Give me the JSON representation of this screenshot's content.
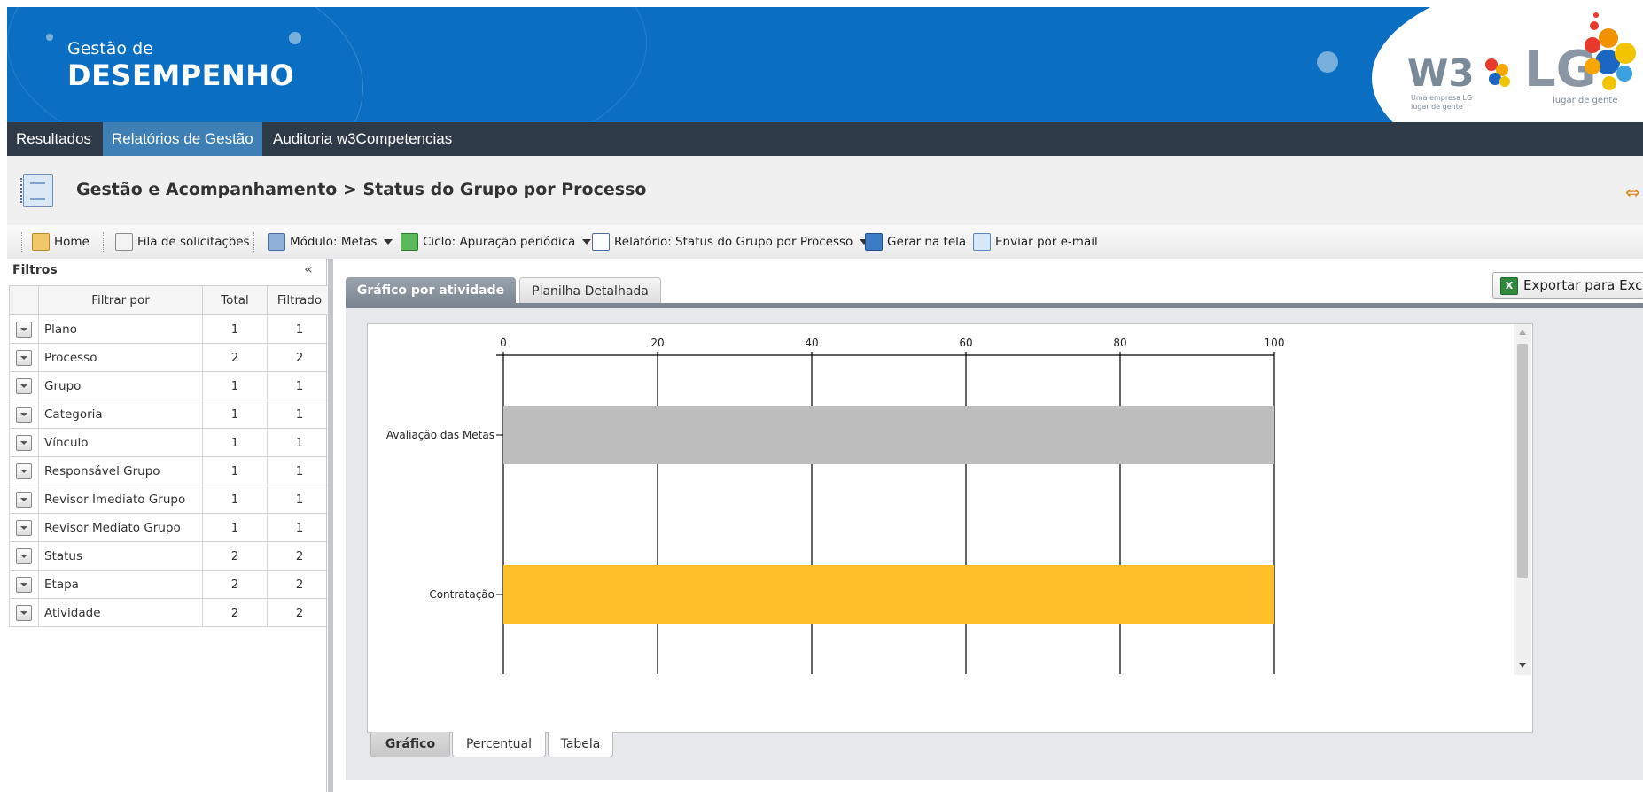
{
  "header": {
    "brand_line1": "Gestão de",
    "brand_line2": "DESEMPENHO",
    "logo_w3": "W3",
    "logo_w3_sub": "Uma empresa LG lugar de gente",
    "logo_lg": "LG",
    "logo_lg_sub": "lugar de gente",
    "colors": {
      "banner": "#0a6fc2",
      "menu": "#2e3a47",
      "menu_active": "#3e7fb5"
    }
  },
  "menu": {
    "items": [
      {
        "label": "Resultados",
        "active": false
      },
      {
        "label": "Relatórios de Gestão",
        "active": true
      },
      {
        "label": "Auditoria w3Competencias",
        "active": false
      }
    ]
  },
  "page": {
    "title": "Gestão e Acompanhamento > Status do Grupo por Processo",
    "title_icon": "report-notebook-icon",
    "expand_icon": "expand-arrows-icon"
  },
  "toolbar": {
    "home": "Home",
    "queue": "Fila de solicitações",
    "module": "Módulo: Metas",
    "cycle": "Ciclo: Apuração periódica",
    "report": "Relatório: Status do Grupo por Processo",
    "generate": "Gerar na tela",
    "email": "Enviar por e-mail"
  },
  "filters": {
    "title": "Filtros",
    "collapse_glyph": "«",
    "columns": [
      "Filtrar por",
      "Total",
      "Filtrado"
    ],
    "rows": [
      {
        "name": "Plano",
        "total": "1",
        "filtered": "1"
      },
      {
        "name": "Processo",
        "total": "2",
        "filtered": "2"
      },
      {
        "name": "Grupo",
        "total": "1",
        "filtered": "1"
      },
      {
        "name": "Categoria",
        "total": "1",
        "filtered": "1"
      },
      {
        "name": "Vínculo",
        "total": "1",
        "filtered": "1"
      },
      {
        "name": "Responsável Grupo",
        "total": "1",
        "filtered": "1"
      },
      {
        "name": "Revisor Imediato Grupo",
        "total": "1",
        "filtered": "1"
      },
      {
        "name": "Revisor Mediato Grupo",
        "total": "1",
        "filtered": "1"
      },
      {
        "name": "Status",
        "total": "2",
        "filtered": "2"
      },
      {
        "name": "Etapa",
        "total": "2",
        "filtered": "2"
      },
      {
        "name": "Atividade",
        "total": "2",
        "filtered": "2"
      }
    ]
  },
  "tabs": {
    "top": [
      "Gráfico por atividade",
      "Planilha Detalhada"
    ],
    "bottom": [
      "Gráfico",
      "Percentual",
      "Tabela"
    ],
    "active_top": "Gráfico por atividade",
    "active_bottom": "Gráfico"
  },
  "export": {
    "label": "Exportar para Excel"
  },
  "chart_data": {
    "type": "bar",
    "orientation": "horizontal",
    "categories": [
      "Avaliação das Metas",
      "Contratação"
    ],
    "values": [
      100,
      100
    ],
    "colors": [
      "#bdbdbd",
      "#fcbf28"
    ],
    "xlim": [
      0,
      100
    ],
    "xticks": [
      0,
      20,
      40,
      60,
      80,
      100
    ],
    "x_axis_position": "top",
    "grid": true,
    "title": "",
    "xlabel": "",
    "ylabel": ""
  }
}
